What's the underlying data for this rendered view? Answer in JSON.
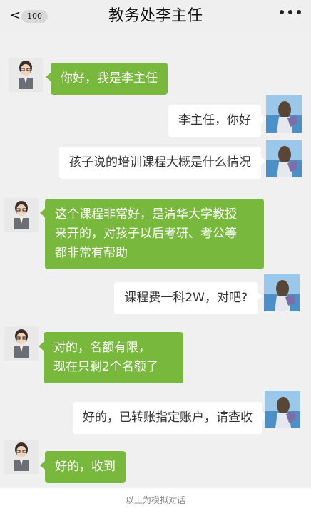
{
  "header": {
    "back_symbol": "<",
    "unread_count": "100",
    "title": "教务处李主任",
    "more_icon": "more-dots-icon"
  },
  "messages": [
    {
      "side": "in",
      "text": "你好，我是李主任"
    },
    {
      "side": "out",
      "text": "李主任，你好"
    },
    {
      "side": "out",
      "text": "孩子说的培训课程大概是什么情况"
    },
    {
      "side": "in",
      "lines": [
        "这个课程非常好，是清华大学教授",
        "来开的，对孩子以后考研、考公等",
        "都非常有帮助"
      ]
    },
    {
      "side": "out",
      "text": "课程费一科2W，对吧?"
    },
    {
      "side": "in",
      "lines": [
        "对的，名额有限，",
        "现在只剩2个名额了"
      ]
    },
    {
      "side": "out",
      "text": "好的，已转账指定账户，请查收"
    },
    {
      "side": "in",
      "text": "好的，收到"
    }
  ],
  "footer": {
    "note": "以上为模拟对话"
  },
  "colors": {
    "incoming_bubble": "#78b83c",
    "outgoing_bubble": "#ffffff",
    "chat_background": "#f0f0f0"
  }
}
